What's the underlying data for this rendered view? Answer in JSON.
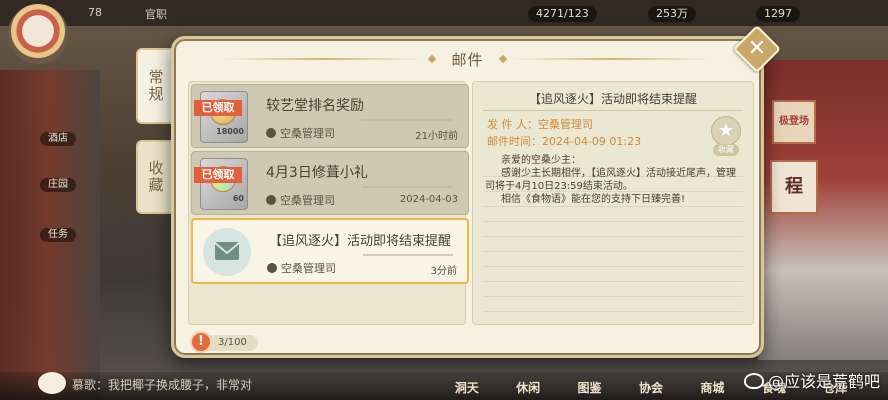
{
  "background": {
    "level": "78",
    "stage": "官职",
    "resources": [
      "4271/123",
      "253万",
      "1297"
    ],
    "left_buttons": [
      "酒店",
      "庄园",
      "任务"
    ],
    "right_posters": [
      "极登场",
      "程"
    ],
    "chat_text": "慕歌：我把椰子换成腰子，非常对",
    "bottom_tabs": [
      "洞天",
      "休闲",
      "图鉴",
      "协会",
      "商城",
      "食魂",
      "仓库"
    ],
    "watermark": "@应该是荒鹤吧"
  },
  "dialog": {
    "title": "邮件",
    "close_label": "✕",
    "tabs": [
      {
        "label": "常规",
        "active": true
      },
      {
        "label": "收藏",
        "active": false
      }
    ],
    "mails": [
      {
        "subject": "较艺堂排名奖励",
        "sender": "空桑管理司",
        "time": "21小时前",
        "claimed_label": "已领取",
        "quantity": "18000",
        "icon": "silver-coin-icon"
      },
      {
        "subject": "4月3日修葺小礼",
        "sender": "空桑管理司",
        "time": "2024-04-03",
        "claimed_label": "已领取",
        "quantity": "60",
        "icon": "rainbow-coin-icon"
      },
      {
        "subject": "【追风逐火】活动即将结束提醒",
        "sender": "空桑管理司",
        "time": "3分前",
        "icon": "envelope-icon",
        "selected": true
      }
    ],
    "detail": {
      "title": "【追风逐火】活动即将结束提醒",
      "sender_label": "发 件 人：",
      "sender": "空桑管理司",
      "time_label": "邮件时间：",
      "time": "2024-04-09  01:23",
      "collect_label": "收藏",
      "body": [
        "亲爱的空桑少主：",
        "感谢少主长期相伴，【追风逐火】活动接近尾声，管理司将于4月10日23:59结束活动。",
        "相信《食物语》能在您的支持下日臻完善!"
      ]
    },
    "footer": {
      "warn": "!",
      "count": "3/100"
    },
    "colors": {
      "panel": "#f6f1e1",
      "accent": "#e8b84a",
      "claimed": "#e2603c",
      "meta_text": "#d2893a"
    }
  }
}
